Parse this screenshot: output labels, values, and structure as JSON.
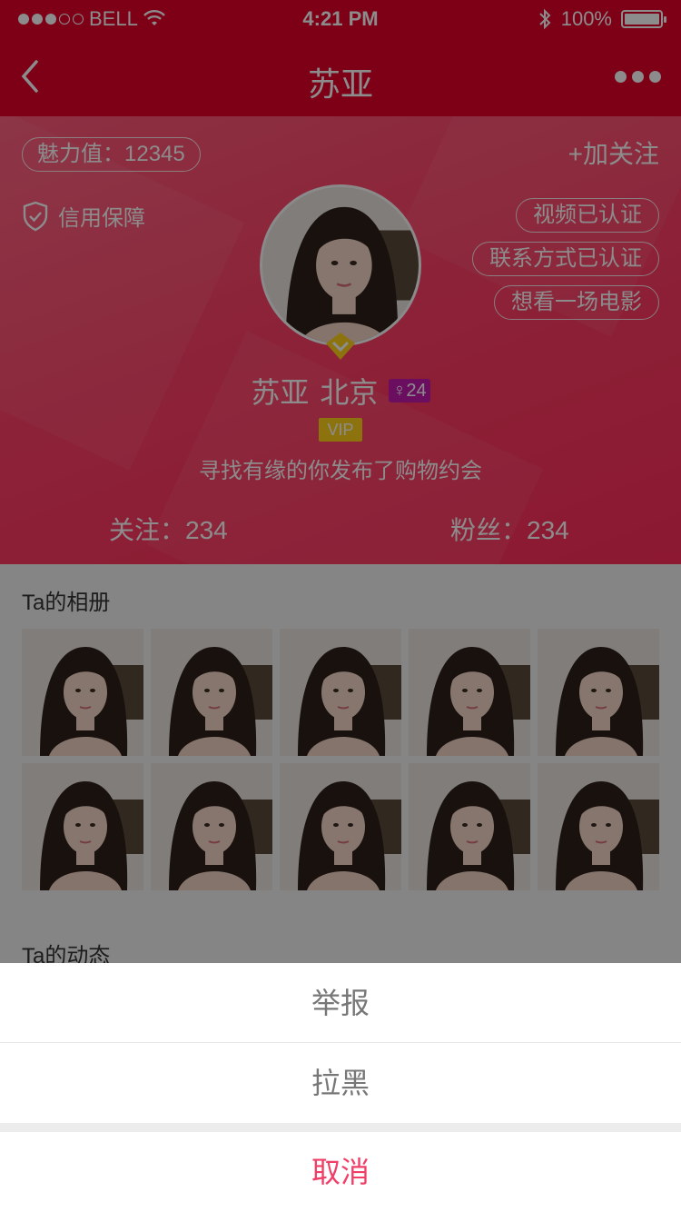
{
  "status_bar": {
    "carrier": "BELL",
    "time": "4:21 PM",
    "battery": "100%",
    "signal_bars_on": 3,
    "signal_bars_total": 5
  },
  "nav": {
    "title": "苏亚"
  },
  "profile": {
    "charm_label": "魅力值：12345",
    "follow_button": "+加关注",
    "credit_label": "信用保障",
    "tags": [
      "视频已认证",
      "联系方式已认证",
      "想看一场电影"
    ],
    "name": "苏亚",
    "city": "北京",
    "gender_age": "♀24",
    "vip": "VIP",
    "signature": "寻找有缘的你发布了购物约会",
    "following": "关注：234",
    "fans": "粉丝：234"
  },
  "album": {
    "title": "Ta的相册",
    "photo_count": 10
  },
  "dynamics": {
    "title": "Ta的动态"
  },
  "action_sheet": {
    "report": "举报",
    "block": "拉黑",
    "cancel": "取消"
  },
  "colors": {
    "primary_red": "#e3002b",
    "profile_pink": "#ff3f66",
    "cancel_red": "#f13e66",
    "vip_gold": "#ffd21a",
    "gender_badge": "#c51bb0"
  }
}
